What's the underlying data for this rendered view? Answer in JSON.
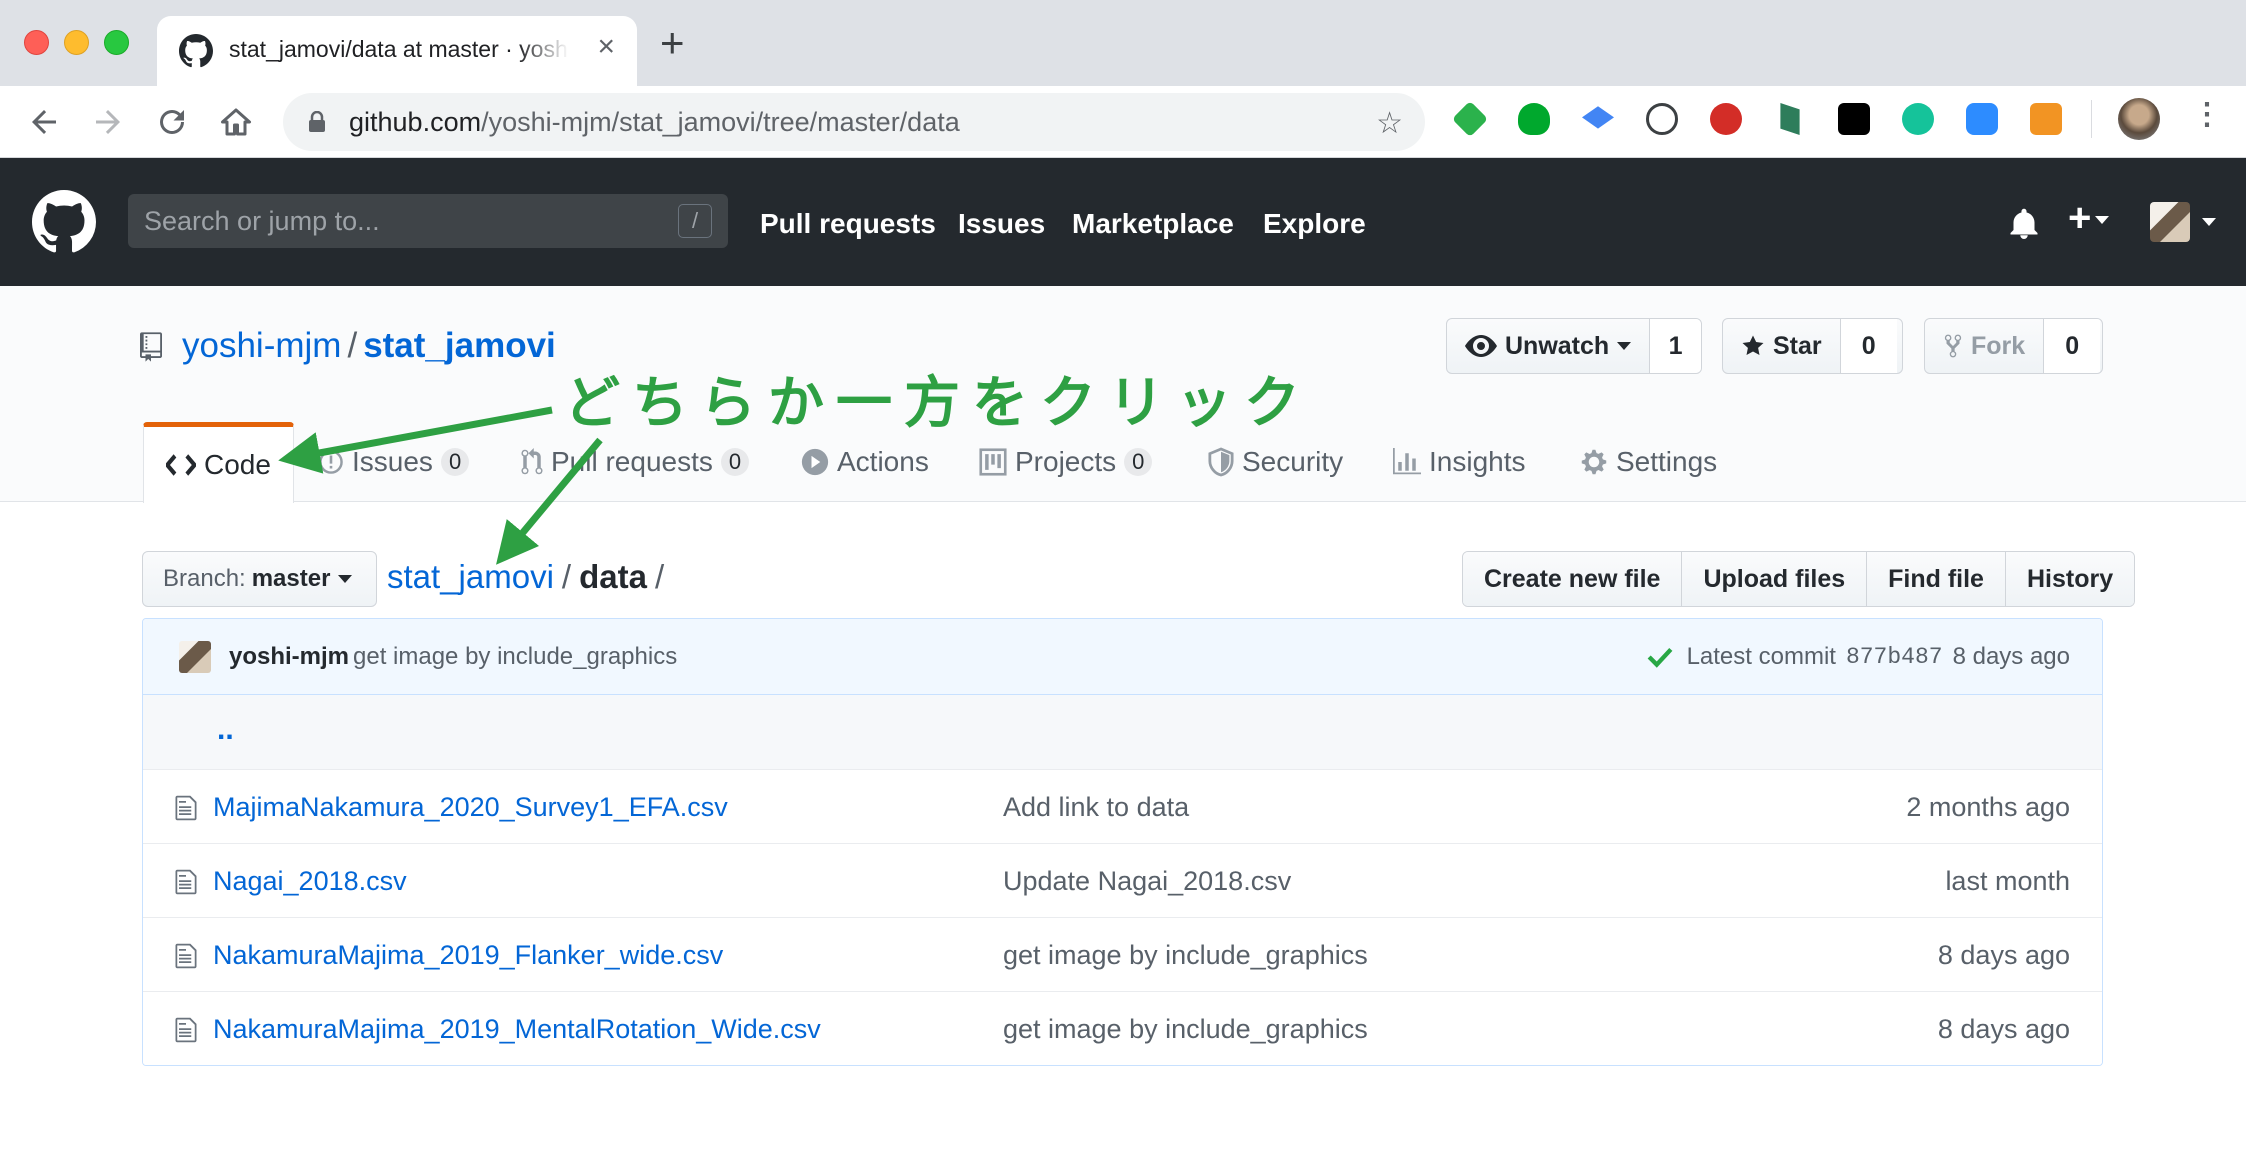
{
  "browser": {
    "tab_title": "stat_jamovi/data at master · yoshi-mjm/stat_jamovi",
    "url_host": "github.com",
    "url_path": "/yoshi-mjm/stat_jamovi/tree/master/data",
    "extensions": [
      "feedly-icon",
      "evernote-icon",
      "scholar-icon",
      "onepassword-icon",
      "lastpass-icon",
      "mendeley-icon",
      "lock-icon",
      "grammarly-icon",
      "zoom-icon",
      "rss-icon"
    ]
  },
  "github": {
    "search_placeholder": "Search or jump to...",
    "slash_key": "/",
    "nav": [
      "Pull requests",
      "Issues",
      "Marketplace",
      "Explore"
    ]
  },
  "repo": {
    "owner": "yoshi-mjm",
    "separator": "/",
    "name": "stat_jamovi",
    "unwatch_label": "Unwatch",
    "watch_count": "1",
    "star_label": "Star",
    "star_count": "0",
    "fork_label": "Fork",
    "fork_count": "0",
    "tabs": {
      "code": "Code",
      "issues": "Issues",
      "issues_count": "0",
      "pulls": "Pull requests",
      "pulls_count": "0",
      "actions": "Actions",
      "projects": "Projects",
      "projects_count": "0",
      "security": "Security",
      "insights": "Insights",
      "settings": "Settings"
    }
  },
  "filenav": {
    "branch_prefix": "Branch:",
    "branch": "master",
    "crumb_root": "stat_jamovi",
    "crumb_sep": "/",
    "crumb_current": "data",
    "crumb_trail": "/",
    "buttons": {
      "create": "Create new file",
      "upload": "Upload files",
      "find": "Find file",
      "history": "History"
    }
  },
  "commit": {
    "author": "yoshi-mjm",
    "message": "get image by include_graphics",
    "latest_label": "Latest commit",
    "sha": "877b487",
    "age": "8 days ago"
  },
  "files": {
    "up": "..",
    "rows": [
      {
        "name": "MajimaNakamura_2020_Survey1_EFA.csv",
        "message": "Add link to data",
        "age": "2 months ago"
      },
      {
        "name": "Nagai_2018.csv",
        "message": "Update Nagai_2018.csv",
        "age": "last month"
      },
      {
        "name": "NakamuraMajima_2019_Flanker_wide.csv",
        "message": "get image by include_graphics",
        "age": "8 days ago"
      },
      {
        "name": "NakamuraMajima_2019_MentalRotation_Wide.csv",
        "message": "get image by include_graphics",
        "age": "8 days ago"
      }
    ]
  },
  "annotation": {
    "text": "どちらか一方をクリック",
    "color": "#2ea043"
  },
  "colors": {
    "link": "#0366d6",
    "header_bg": "#24292e",
    "tab_accent": "#e36209"
  }
}
